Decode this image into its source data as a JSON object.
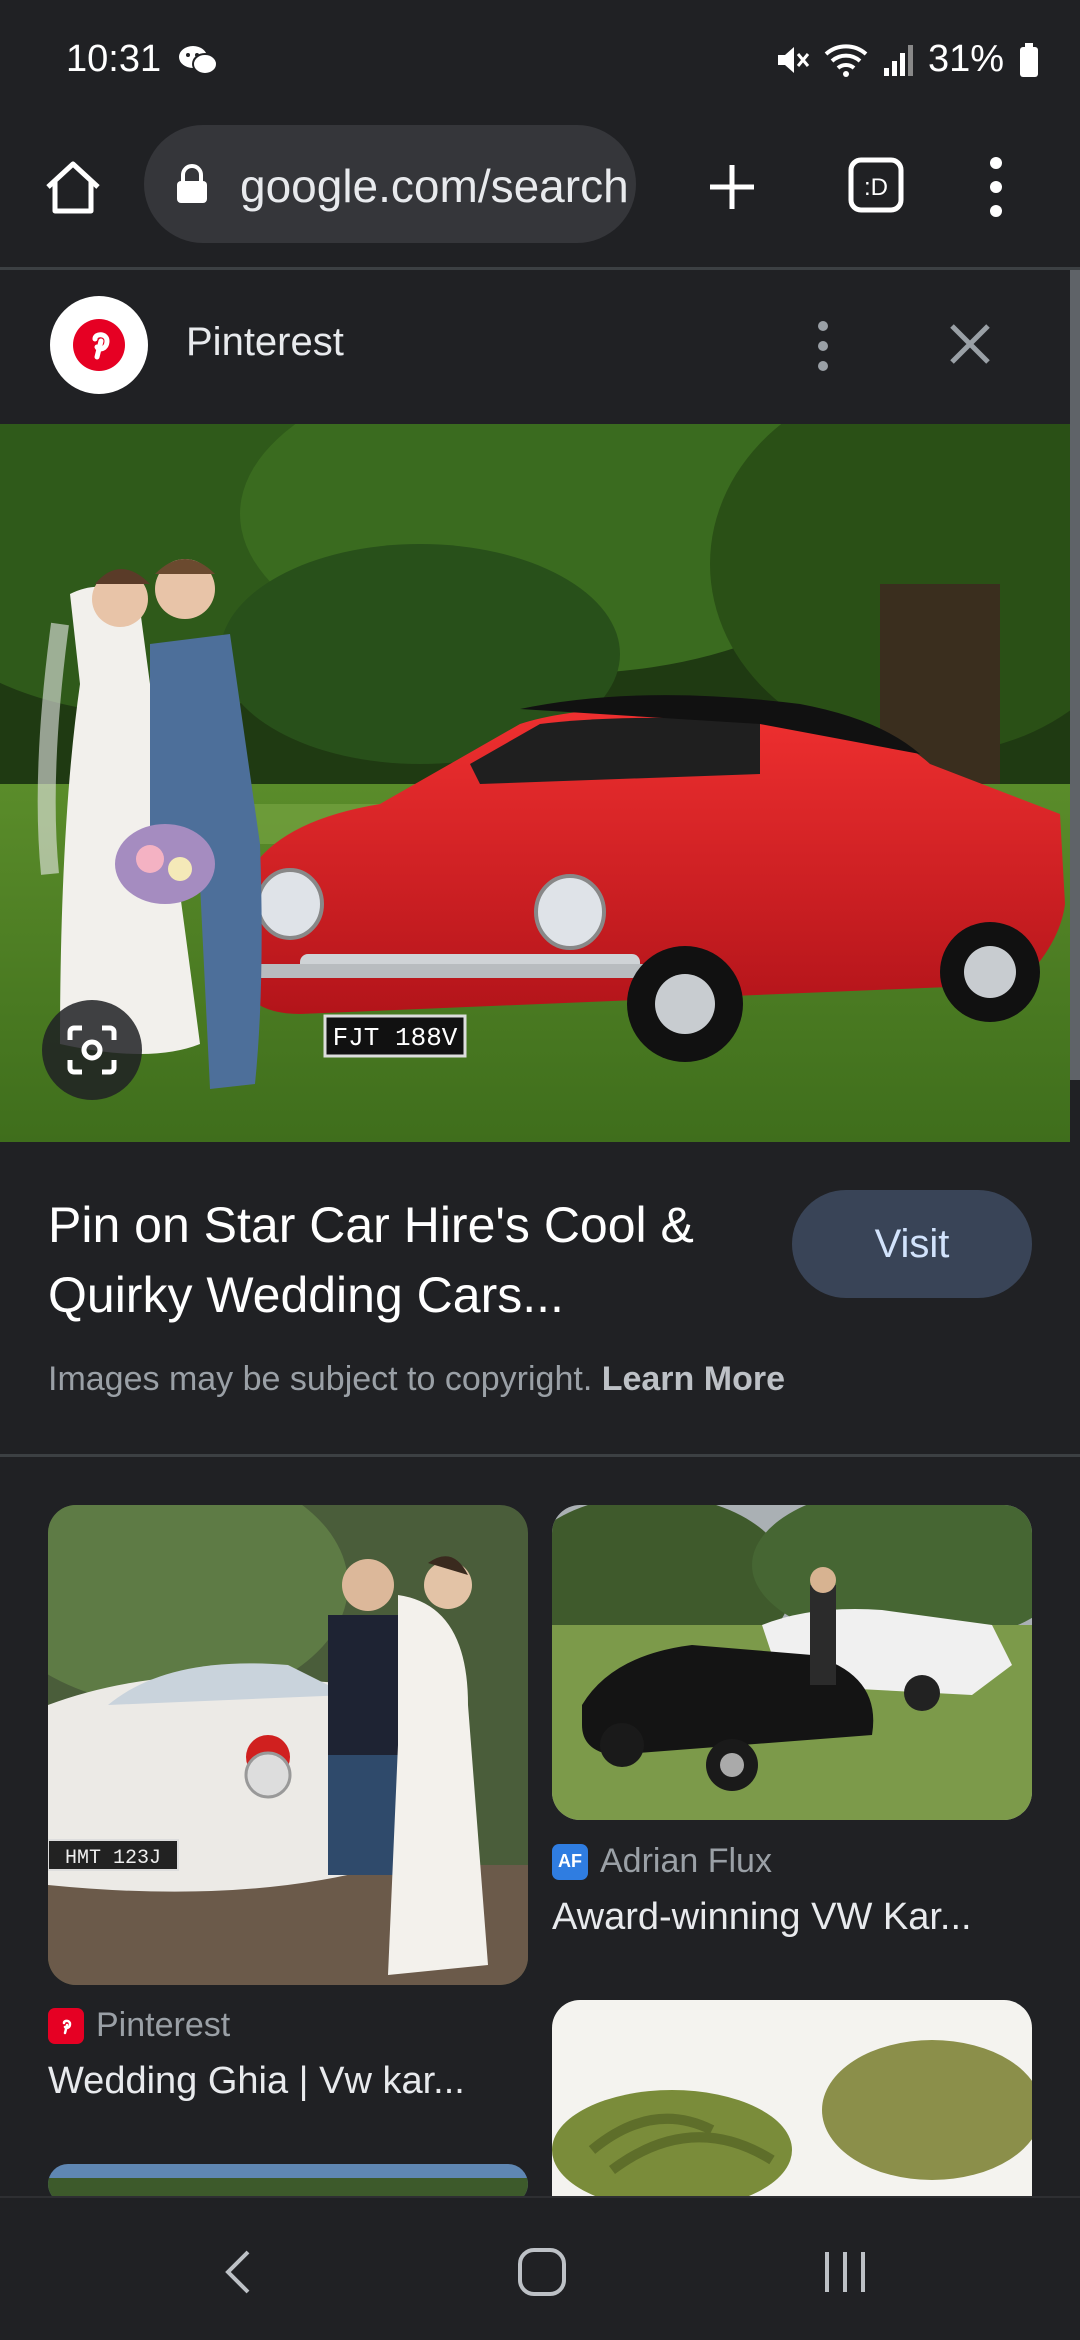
{
  "status": {
    "time": "10:31",
    "battery": "31%"
  },
  "browser": {
    "url": "google.com/search"
  },
  "source": {
    "name": "Pinterest"
  },
  "result": {
    "title": "Pin on Star Car Hire's Cool & Quirky Wedding Cars...",
    "visit_label": "Visit",
    "copyright_text": "Images may be subject to copyright.",
    "learn_more_label": "Learn More",
    "plate_text": "FJT 188V"
  },
  "related": [
    {
      "source": "Pinterest",
      "title": "Wedding Ghia | Vw kar...",
      "plate": "HMT 123J"
    },
    {
      "source": "Adrian Flux",
      "favicon_text": "AF",
      "title": "Award-winning VW Kar..."
    }
  ],
  "colors": {
    "background": "#202124",
    "visit_button": "#394457",
    "car_red": "#d81f26"
  }
}
